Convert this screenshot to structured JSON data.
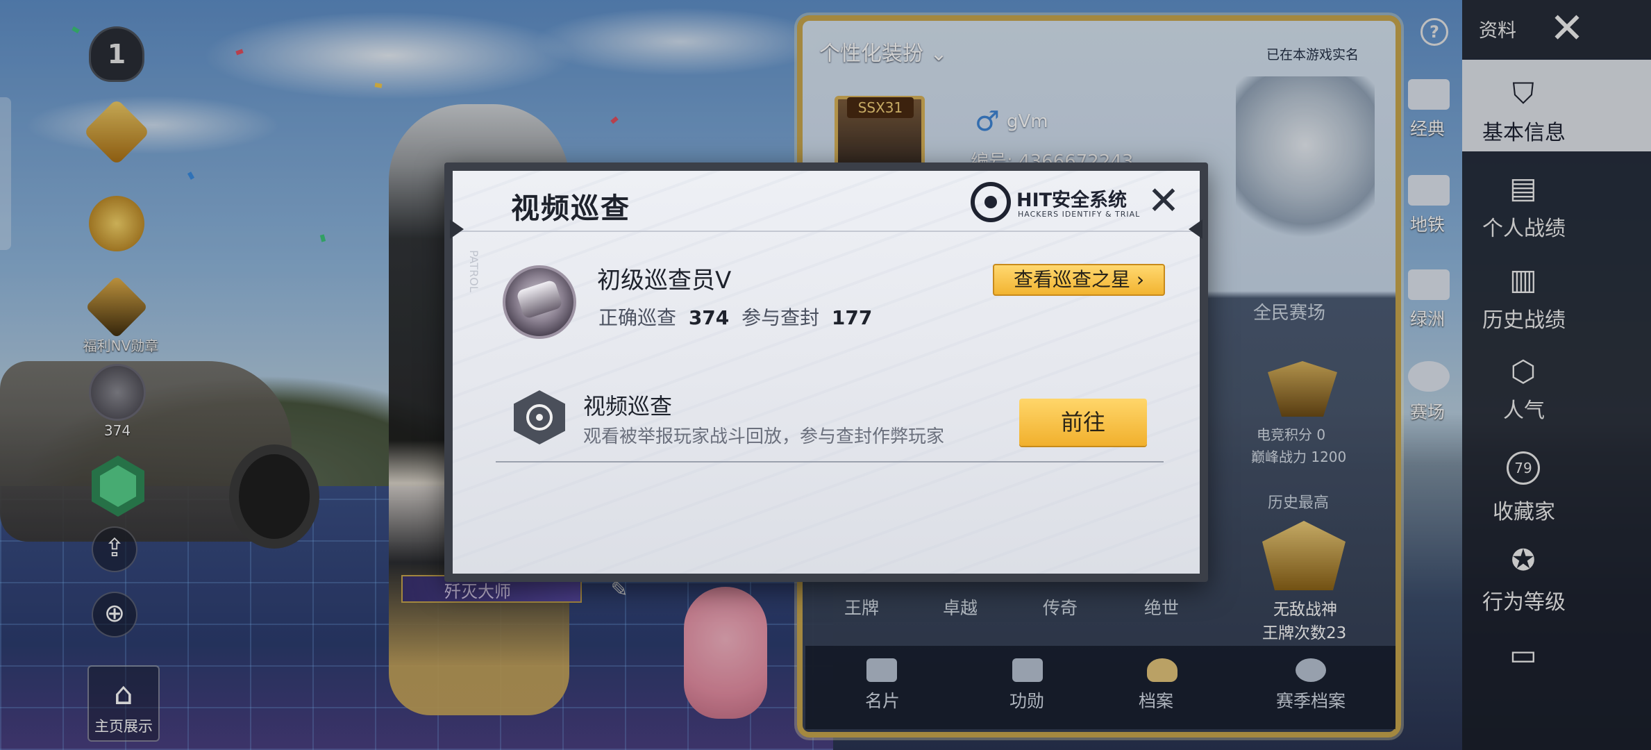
{
  "left_column": {
    "rank_number": "1",
    "tier_3_label": "福利NV勋章",
    "patrol_count": "374",
    "home_display_label": "主页展示"
  },
  "profile_card": {
    "title": "个性化装扮",
    "verified_text": "已在本游戏实名",
    "avatar_tag": "SSX31",
    "gender_symbol": "♂",
    "player_name": "gVm",
    "player_id": "编号: 4366672243",
    "season_title": "全民赛场",
    "esports_points": "电竞积分 0",
    "peak_power": "巅峰战力 1200",
    "history_best_title": "历史最高",
    "history_title": "无敌战神",
    "history_ace_count": "王牌次数23",
    "rank_labels": [
      "王牌",
      "卓越",
      "传奇",
      "绝世"
    ],
    "bottom_tabs": [
      "名片",
      "功勋",
      "档案",
      "赛季档案"
    ],
    "side_items": [
      "经典",
      "地铁",
      "绿洲",
      "赛场"
    ]
  },
  "right_nav": {
    "header_label": "资料",
    "close_symbol": "✕",
    "help_symbol": "?",
    "items": [
      {
        "label": "基本信息",
        "icon": "user-shield-icon",
        "selected": true
      },
      {
        "label": "个人战绩",
        "icon": "document-chart-icon",
        "selected": false
      },
      {
        "label": "历史战绩",
        "icon": "document-edit-icon",
        "selected": false
      },
      {
        "label": "人气",
        "icon": "popularity-icon",
        "selected": false
      },
      {
        "label": "收藏家",
        "icon": "collector-badge-icon",
        "badge": "79",
        "selected": false
      },
      {
        "label": "行为等级",
        "icon": "behavior-star-icon",
        "selected": false
      },
      {
        "label": "",
        "icon": "document-icon",
        "selected": false
      }
    ]
  },
  "dialog": {
    "title": "视频巡查",
    "brand_name": "HIT安全系统",
    "brand_subtitle": "HACKERS IDENTIFY & TRIAL",
    "close_symbol": "✕",
    "rank_title": "初级巡查员V",
    "stat_correct_label": "正确巡查",
    "stat_correct_value": "374",
    "stat_ban_label": "参与查封",
    "stat_ban_value": "177",
    "star_button_label": "查看巡查之星 ›",
    "patrol_title": "视频巡查",
    "patrol_description": "观看被举报玩家战斗回放，参与查封作弊玩家",
    "go_button_label": "前往",
    "watermark_text": "PATROL"
  },
  "character": {
    "nametag": "歼灭大师"
  },
  "colors": {
    "accent_gold": "#f2b431",
    "card_frame": "#c9a64e",
    "dialog_bg": "#eef0f5",
    "nav_bg": "#1a1e28"
  }
}
